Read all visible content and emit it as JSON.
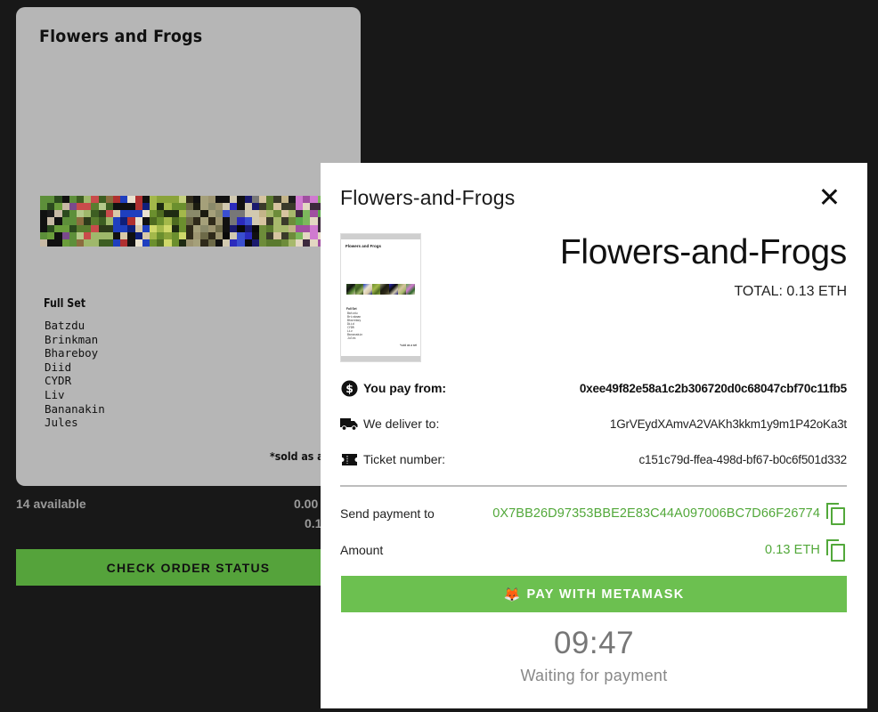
{
  "card": {
    "title": "Flowers and Frogs",
    "subhead": "Full Set",
    "artists": [
      "Batzdu",
      "Brinkman",
      "Bhareboy",
      "Diid",
      "CYDR",
      "Liv",
      "Bananakin",
      "Jules"
    ],
    "note": "*sold as a"
  },
  "listing": {
    "available": "14 available",
    "price_line1": "0.00",
    "price_line2": "0.1"
  },
  "check_button": "CHECK ORDER STATUS",
  "modal": {
    "title": "Flowers-and-Frogs",
    "product_name": "Flowers-and-Frogs",
    "total": "TOTAL: 0.13 ETH",
    "thumbnail": {
      "title": "Flowers and Frogs",
      "subhead": "Full Set",
      "note": "*sold as a set"
    },
    "pay_from": {
      "label": "You pay from:",
      "value": "0xee49f82e58a1c2b306720d0c68047cbf70c11fb5",
      "icon": "dollar-coin-icon"
    },
    "deliver_to": {
      "label": "We deliver to:",
      "value": "1GrVEydXAmvA2VAKh3kkm1y9m1P42oKa3t",
      "icon": "truck-icon"
    },
    "ticket": {
      "label": "Ticket number:",
      "value": "c151c79d-ffea-498d-bf67-b0c6f501d332",
      "icon": "ticket-icon"
    },
    "send_payment": {
      "label": "Send payment to",
      "value": "0X7BB26D97353BBE2E83C44A097006BC7D66F26774"
    },
    "amount": {
      "label": "Amount",
      "value": "0.13 ETH"
    },
    "metamask_button": "PAY WITH METAMASK",
    "timer": "09:47",
    "status": "Waiting for payment"
  },
  "colors": {
    "page_bg": "#181818",
    "card_bg": "#b6b6b6",
    "accent_green": "#52a83a",
    "button_green": "#6cc050",
    "check_button_green": "#55a33b"
  }
}
